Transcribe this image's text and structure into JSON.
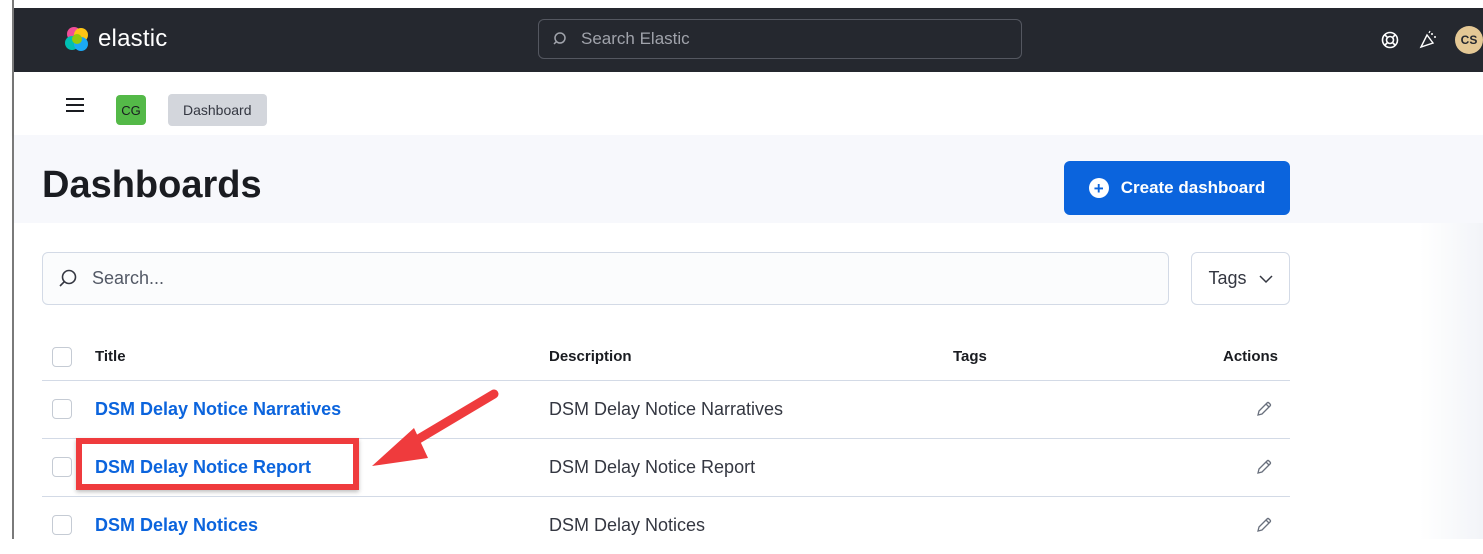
{
  "topbar": {
    "logo_text": "elastic",
    "search_placeholder": "Search Elastic",
    "avatar_initials": "CS",
    "icons": [
      "help-icon",
      "newsfeed-icon"
    ]
  },
  "breadcrumbs": {
    "space_initials": "CG",
    "items": [
      "Dashboard"
    ]
  },
  "page": {
    "title": "Dashboards",
    "create_button_label": "Create dashboard"
  },
  "filters": {
    "search_placeholder": "Search...",
    "tags_label": "Tags"
  },
  "table": {
    "columns": [
      "Title",
      "Description",
      "Tags",
      "Actions"
    ],
    "rows": [
      {
        "title": "DSM Delay Notice Narratives",
        "description": "DSM Delay Notice Narratives",
        "tags": ""
      },
      {
        "title": "DSM Delay Notice Report",
        "description": "DSM Delay Notice Report",
        "tags": ""
      },
      {
        "title": "DSM Delay Notices",
        "description": "DSM Delay Notices",
        "tags": ""
      }
    ]
  },
  "annotation": {
    "highlighted_row": "DSM Delay Notice Report",
    "color": "#ef3b3d"
  },
  "colors": {
    "topbar_bg": "#25282f",
    "primary": "#0b64dd",
    "space_badge": "#54b948",
    "avatar": "#e4c895"
  }
}
